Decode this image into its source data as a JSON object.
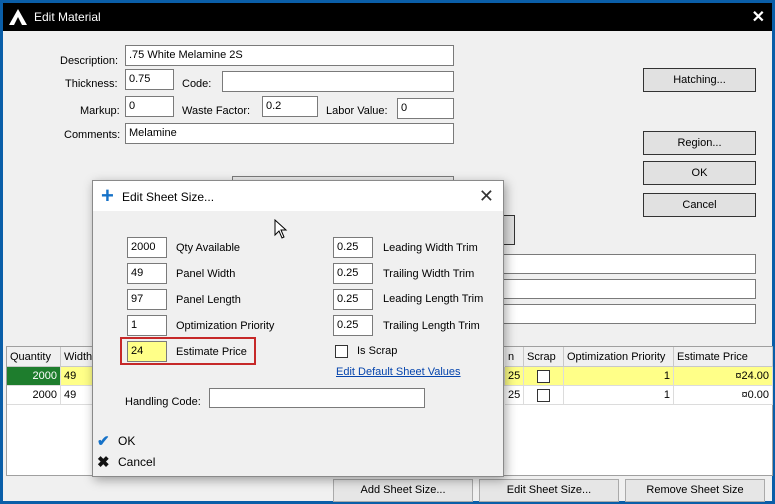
{
  "window": {
    "title": "Edit Material",
    "close_glyph": "✕"
  },
  "form": {
    "description_label": "Description:",
    "description_value": ".75 White Melamine 2S",
    "thickness_label": "Thickness:",
    "thickness_value": "0.75",
    "code_label": "Code:",
    "code_value": "",
    "markup_label": "Markup:",
    "markup_value": "0",
    "waste_label": "Waste Factor:",
    "waste_value": "0.2",
    "labor_label": "Labor Value:",
    "labor_value": "0",
    "comments_label": "Comments:",
    "comments_value": "Melamine"
  },
  "side_buttons": {
    "hatching": "Hatching...",
    "region": "Region...",
    "ok": "OK",
    "cancel": "Cancel"
  },
  "table": {
    "headers_left": [
      "Quantity",
      "Width"
    ],
    "headers_right": [
      "n",
      "Scrap",
      "Optimization Priority",
      "Estimate Price"
    ],
    "rows": [
      {
        "quantity": "2000",
        "width": "49",
        "trim": "25",
        "opt": "1",
        "price": "¤24.00"
      },
      {
        "quantity": "2000",
        "width": "49",
        "trim": "25",
        "opt": "1",
        "price": "¤0.00"
      }
    ]
  },
  "bottom_buttons": {
    "add": "Add Sheet Size...",
    "edit": "Edit Sheet Size...",
    "remove": "Remove Sheet Size"
  },
  "dialog": {
    "title": "Edit Sheet Size...",
    "qty_value": "2000",
    "qty_label": "Qty Available",
    "width_value": "49",
    "width_label": "Panel Width",
    "length_value": "97",
    "length_label": "Panel Length",
    "priority_value": "1",
    "priority_label": "Optimization Priority",
    "price_value": "24",
    "price_label": "Estimate Price",
    "lwt_value": "0.25",
    "lwt_label": "Leading Width Trim",
    "twt_value": "0.25",
    "twt_label": "Trailing Width Trim",
    "llt_value": "0.25",
    "llt_label": "Leading Length Trim",
    "tlt_value": "0.25",
    "tlt_label": "Trailing Length Trim",
    "scrap_label": "Is Scrap",
    "default_link": "Edit Default Sheet Values",
    "handling_label": "Handling Code:",
    "handling_value": "",
    "ok_label": "OK",
    "cancel_label": "Cancel"
  },
  "colors": {
    "accent": "#0a5ea8",
    "selected_row": "#1e7d2d",
    "highlight": "#ffff88",
    "price_box": "#c62828",
    "link": "#0645ad"
  }
}
